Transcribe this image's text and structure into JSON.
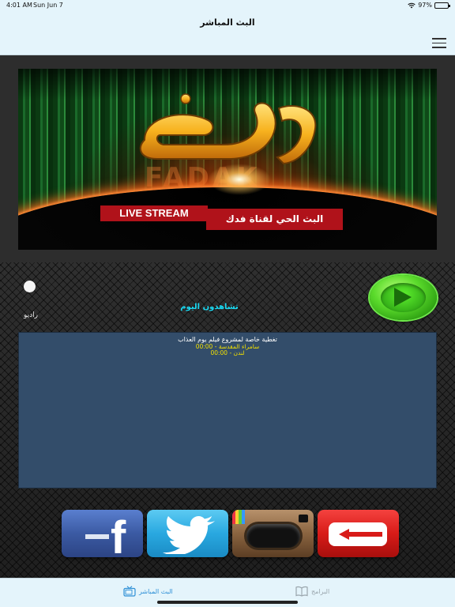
{
  "status_bar": {
    "time": "4:01 AM",
    "date": "Sun Jun 7",
    "battery": "97%"
  },
  "nav": {
    "title": "البث المباشر"
  },
  "banner": {
    "logo_text": "فدك",
    "faint_text": "FADAK",
    "live_stream": "LIVE STREAM",
    "caption": "البث الحي لقناة فدك"
  },
  "controls": {
    "radio_label": "راديو",
    "watching_label": "تشاهدون اليوم"
  },
  "schedule": {
    "title": "تغطية خاصة لمشروع فيلم يوم العذاب",
    "line1": "سامراء المقدسة - 00:00",
    "line2": "لندن - 00:00"
  },
  "social": [
    "facebook-icon",
    "twitter-icon",
    "instagram-icon",
    "youtube-icon"
  ],
  "tabs": {
    "live": "البث المباشر",
    "programs": "البرامج"
  },
  "colors": {
    "accent": "#2d8fd6",
    "watching": "#19d7f0",
    "schedule_text": "#f2e000",
    "banner_red": "#b0121a"
  }
}
